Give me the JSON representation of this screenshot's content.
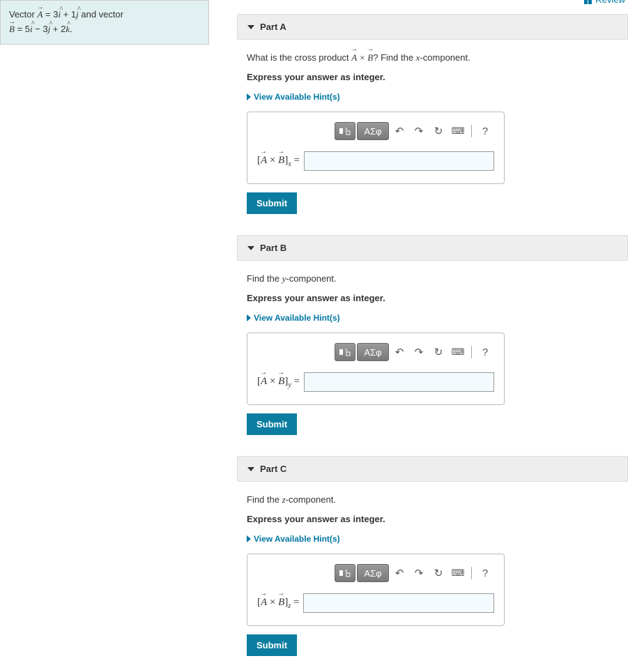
{
  "review": "Review",
  "problem_statement": {
    "prefix": "Vector ",
    "vec_a": "A",
    "eq_a": " = 3",
    "i": "i",
    "plus": " + 1",
    "j": "j",
    "and": " and vector",
    "vec_b": "B",
    "eq_b": " = 5",
    "minus": " − 3",
    "plus2": " + 2",
    "k": "k",
    "period": "."
  },
  "hints_label": "View Available Hint(s)",
  "submit_label": "Submit",
  "greek_label": "ΑΣφ",
  "help_label": "?",
  "parts": {
    "a": {
      "title": "Part A",
      "prompt_pre": "What is the cross product ",
      "prompt_post": "? Find the ",
      "component": "x",
      "prompt_end": "-component.",
      "instruction": "Express your answer as integer.",
      "label_sub": "x"
    },
    "b": {
      "title": "Part B",
      "prompt_pre": "Find the ",
      "component": "y",
      "prompt_end": "-component.",
      "instruction": "Express your answer as integer.",
      "label_sub": "y"
    },
    "c": {
      "title": "Part C",
      "prompt_pre": "Find the ",
      "component": "z",
      "prompt_end": "-component.",
      "instruction": "Express your answer as integer.",
      "label_sub": "z"
    }
  }
}
